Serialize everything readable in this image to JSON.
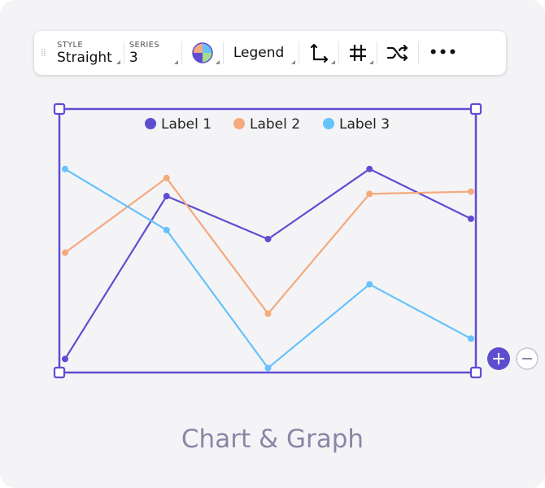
{
  "toolbar": {
    "style_label": "STYLE",
    "style_value": "Straight",
    "series_label": "SERIES",
    "series_value": "3",
    "legend_label": "Legend",
    "icons": [
      "drag-handle-icon",
      "color-palette-icon",
      "axes-icon",
      "grid-icon",
      "shuffle-icon",
      "more-icon"
    ]
  },
  "zoom": {
    "plus": "+",
    "minus": "−"
  },
  "widget_title": "Chart & Graph",
  "chart_data": {
    "type": "line",
    "style": "straight",
    "x": [
      1,
      2,
      3,
      4,
      5
    ],
    "ylim": [
      0,
      100
    ],
    "grid": false,
    "legend_placement": "top",
    "series": [
      {
        "name": "Label 1",
        "color": "#5f4dd0",
        "values": [
          6,
          78,
          59,
          90,
          68
        ]
      },
      {
        "name": "Label 2",
        "color": "#f5a97c",
        "values": [
          53,
          86,
          26,
          79,
          80
        ]
      },
      {
        "name": "Label 3",
        "color": "#66c2fb",
        "values": [
          90,
          63,
          2,
          39,
          15
        ]
      }
    ]
  }
}
